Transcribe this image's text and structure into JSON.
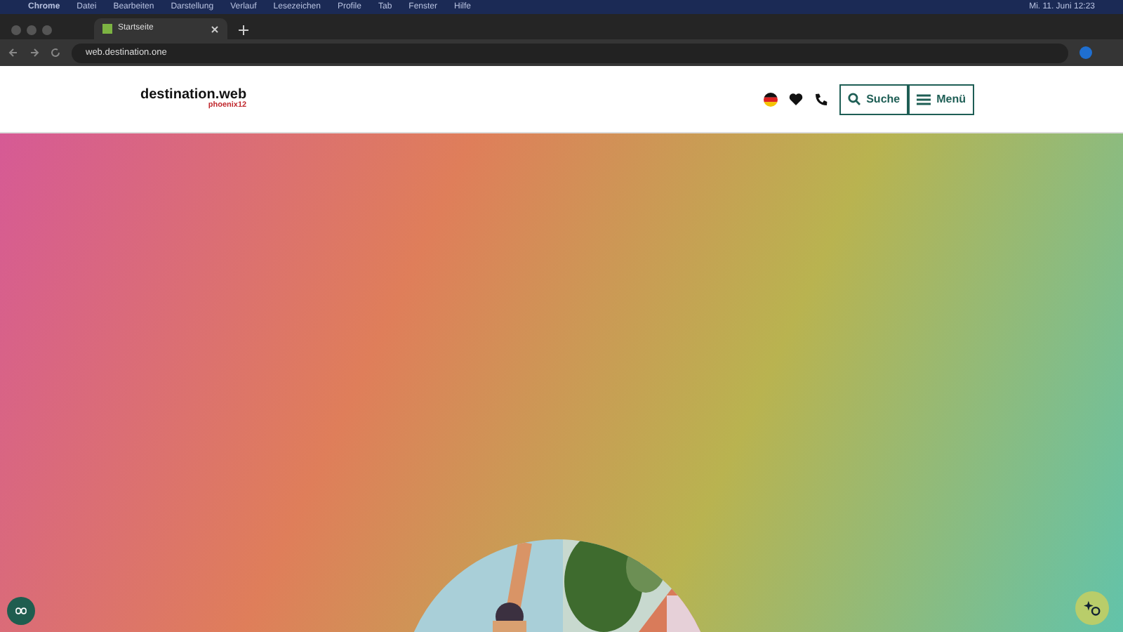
{
  "menu_bar": {
    "app": "Chrome",
    "items": [
      "Datei",
      "Bearbeiten",
      "Darstellung",
      "Verlauf",
      "Lesezeichen",
      "Profile",
      "Tab",
      "Fenster",
      "Hilfe"
    ],
    "clock": "Mi. 11. Juni 12:23"
  },
  "tabs": [
    {
      "title": "Startseite",
      "selected": true
    }
  ],
  "address_bar": {
    "url": "web.destination.one"
  },
  "site_header": {
    "logo": {
      "title": "destination.web",
      "subtitle": "phoenix12"
    },
    "search_button": "Suche",
    "menu_button": "Menü"
  }
}
